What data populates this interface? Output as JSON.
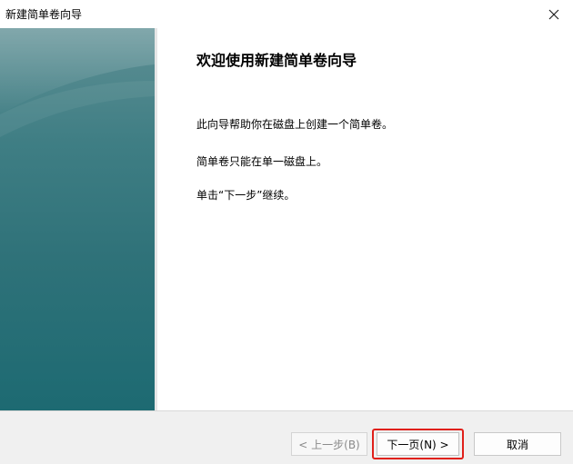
{
  "window": {
    "title": "新建简单卷向导",
    "close_icon": "close-icon"
  },
  "main": {
    "heading": "欢迎使用新建简单卷向导",
    "paragraphs": [
      "此向导帮助你在磁盘上创建一个简单卷。",
      "简单卷只能在单一磁盘上。",
      "单击“下一步”继续。"
    ]
  },
  "footer": {
    "back_label": "< 上一步(B)",
    "next_label": "下一页(N) >",
    "cancel_label": "取消"
  },
  "colors": {
    "side_panel": "#2f7279",
    "highlight": "#e0201a",
    "footer_bg": "#f0f0f0"
  }
}
